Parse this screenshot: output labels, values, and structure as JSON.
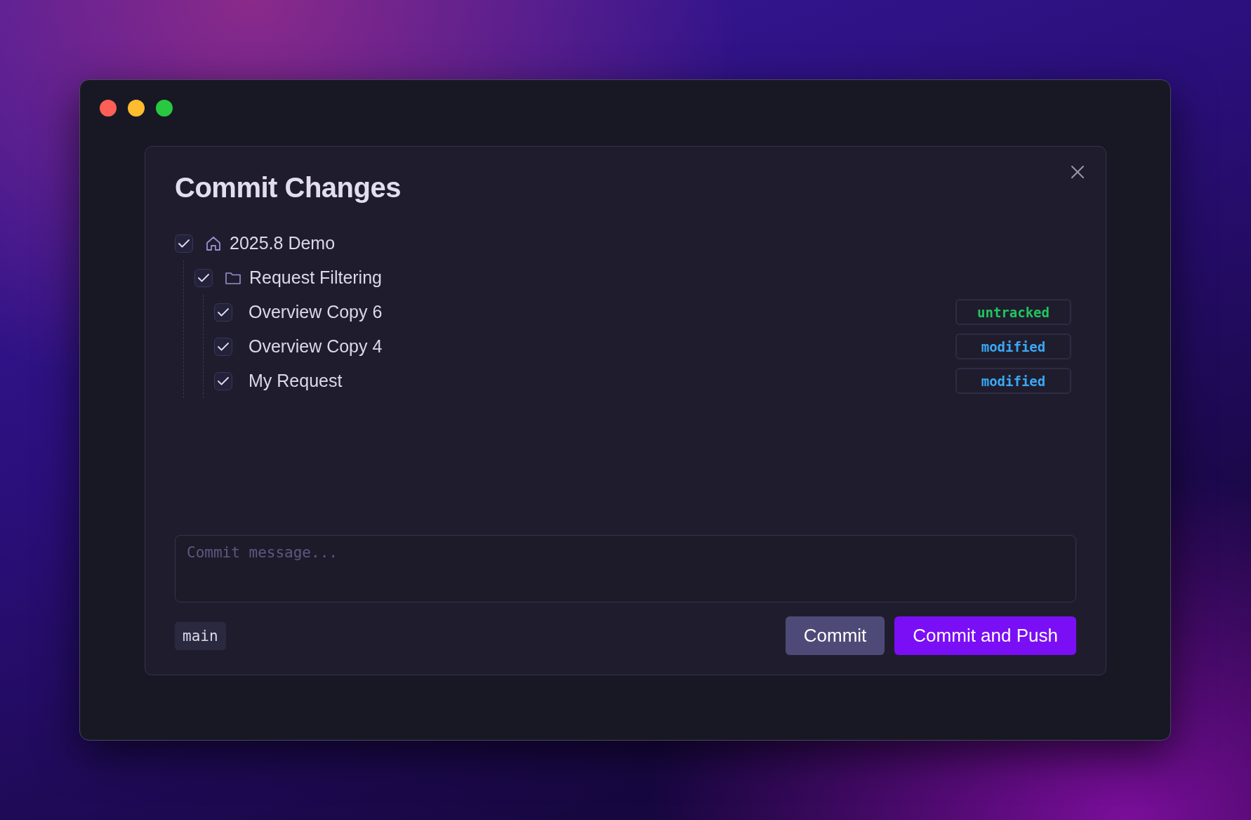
{
  "dialog": {
    "title": "Commit Changes",
    "tree": [
      {
        "kind": "collection",
        "label": "2025.8 Demo",
        "checked": true,
        "children": [
          {
            "kind": "folder",
            "label": "Request Filtering",
            "checked": true,
            "children": [
              {
                "kind": "request",
                "label": "Overview Copy 6",
                "checked": true,
                "status": {
                  "label": "untracked",
                  "color": "#22c55e"
                }
              },
              {
                "kind": "request",
                "label": "Overview Copy 4",
                "checked": true,
                "status": {
                  "label": "modified",
                  "color": "#3aa8f5"
                }
              },
              {
                "kind": "request",
                "label": "My Request",
                "checked": true,
                "status": {
                  "label": "modified",
                  "color": "#3aa8f5"
                }
              }
            ]
          }
        ]
      }
    ],
    "message_field": {
      "placeholder": "Commit message..."
    },
    "branch": "main",
    "buttons": [
      {
        "label": "Commit",
        "kind": "secondary"
      },
      {
        "label": "Commit and Push",
        "kind": "primary"
      }
    ]
  }
}
